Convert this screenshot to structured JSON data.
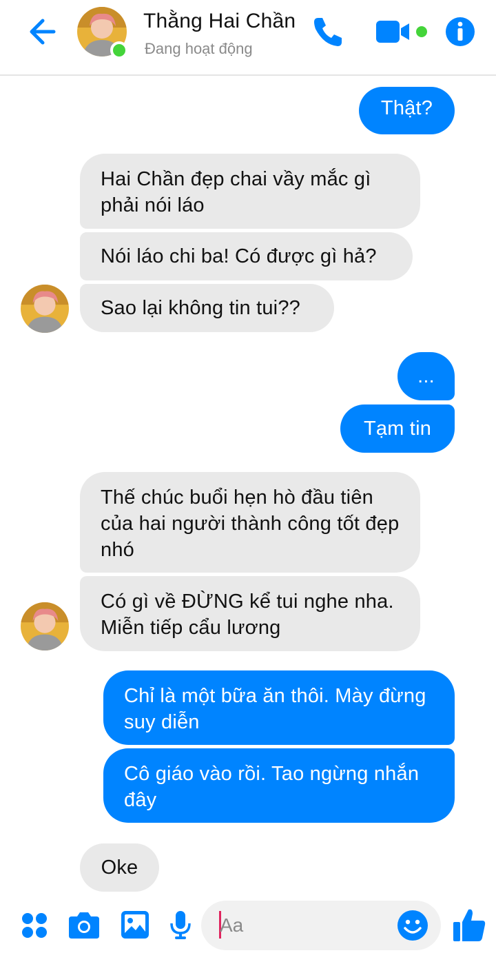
{
  "header": {
    "contact_name": "Thằng Hai Chần",
    "status": "Đang hoạt động",
    "back_icon": "arrow-left-icon",
    "call_icon": "phone-icon",
    "video_icon": "video-camera-icon",
    "info_icon": "info-icon"
  },
  "messages": [
    {
      "direction": "outgoing",
      "text": "Thật?"
    },
    {
      "direction": "incoming",
      "text": "Hai Chần đẹp chai vầy mắc gì phải nói láo"
    },
    {
      "direction": "incoming",
      "text": "Nói láo chi ba! Có được gì hả?"
    },
    {
      "direction": "incoming",
      "text": "Sao lại không tin tui??"
    },
    {
      "direction": "outgoing",
      "text": "..."
    },
    {
      "direction": "outgoing",
      "text": "Tạm tin"
    },
    {
      "direction": "incoming",
      "text": "Thế chúc buổi hẹn hò đầu tiên của hai người thành công tốt đẹp nhó"
    },
    {
      "direction": "incoming",
      "text": "Có gì về ĐỪNG kể tui nghe nha. Miễn tiếp cẩu lương"
    },
    {
      "direction": "outgoing",
      "text": "Chỉ là một bữa ăn thôi. Mày đừng suy diễn"
    },
    {
      "direction": "outgoing",
      "text": "Cô giáo vào rồi. Tao ngừng nhắn đây"
    },
    {
      "direction": "incoming",
      "text": "Oke"
    }
  ],
  "composer": {
    "placeholder": "Aa",
    "menu_icon": "four-dots-icon",
    "camera_icon": "camera-icon",
    "gallery_icon": "image-icon",
    "mic_icon": "microphone-icon",
    "emoji_icon": "smiley-icon",
    "like_icon": "thumbs-up-icon"
  },
  "colors": {
    "accent": "#0084ff",
    "incoming_bubble": "#e9e9e9",
    "online": "#44d43a"
  }
}
